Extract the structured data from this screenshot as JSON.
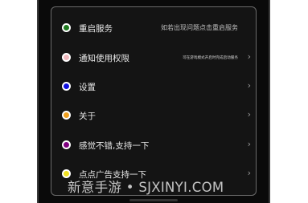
{
  "menu": {
    "items": [
      {
        "label": "重启服务",
        "hint": "如若出现问题点击重启服务",
        "color": "#1f7a1f"
      },
      {
        "label": "通知使用权限",
        "hint": "可在游戏模式开启时完成启动服务",
        "color": "#f0b8bd"
      },
      {
        "label": "设置",
        "hint": "",
        "color": "#1010e0"
      },
      {
        "label": "关于",
        "hint": "",
        "color": "#f0a020"
      },
      {
        "label": "感觉不错,支持一下",
        "hint": "",
        "color": "#800080"
      },
      {
        "label": "点点广告支持一下",
        "hint": "",
        "color": "#f0e020"
      }
    ],
    "chevron": "chevron-right-icon"
  },
  "watermark": {
    "text": "新意手游 • SJXINYI.COM"
  }
}
